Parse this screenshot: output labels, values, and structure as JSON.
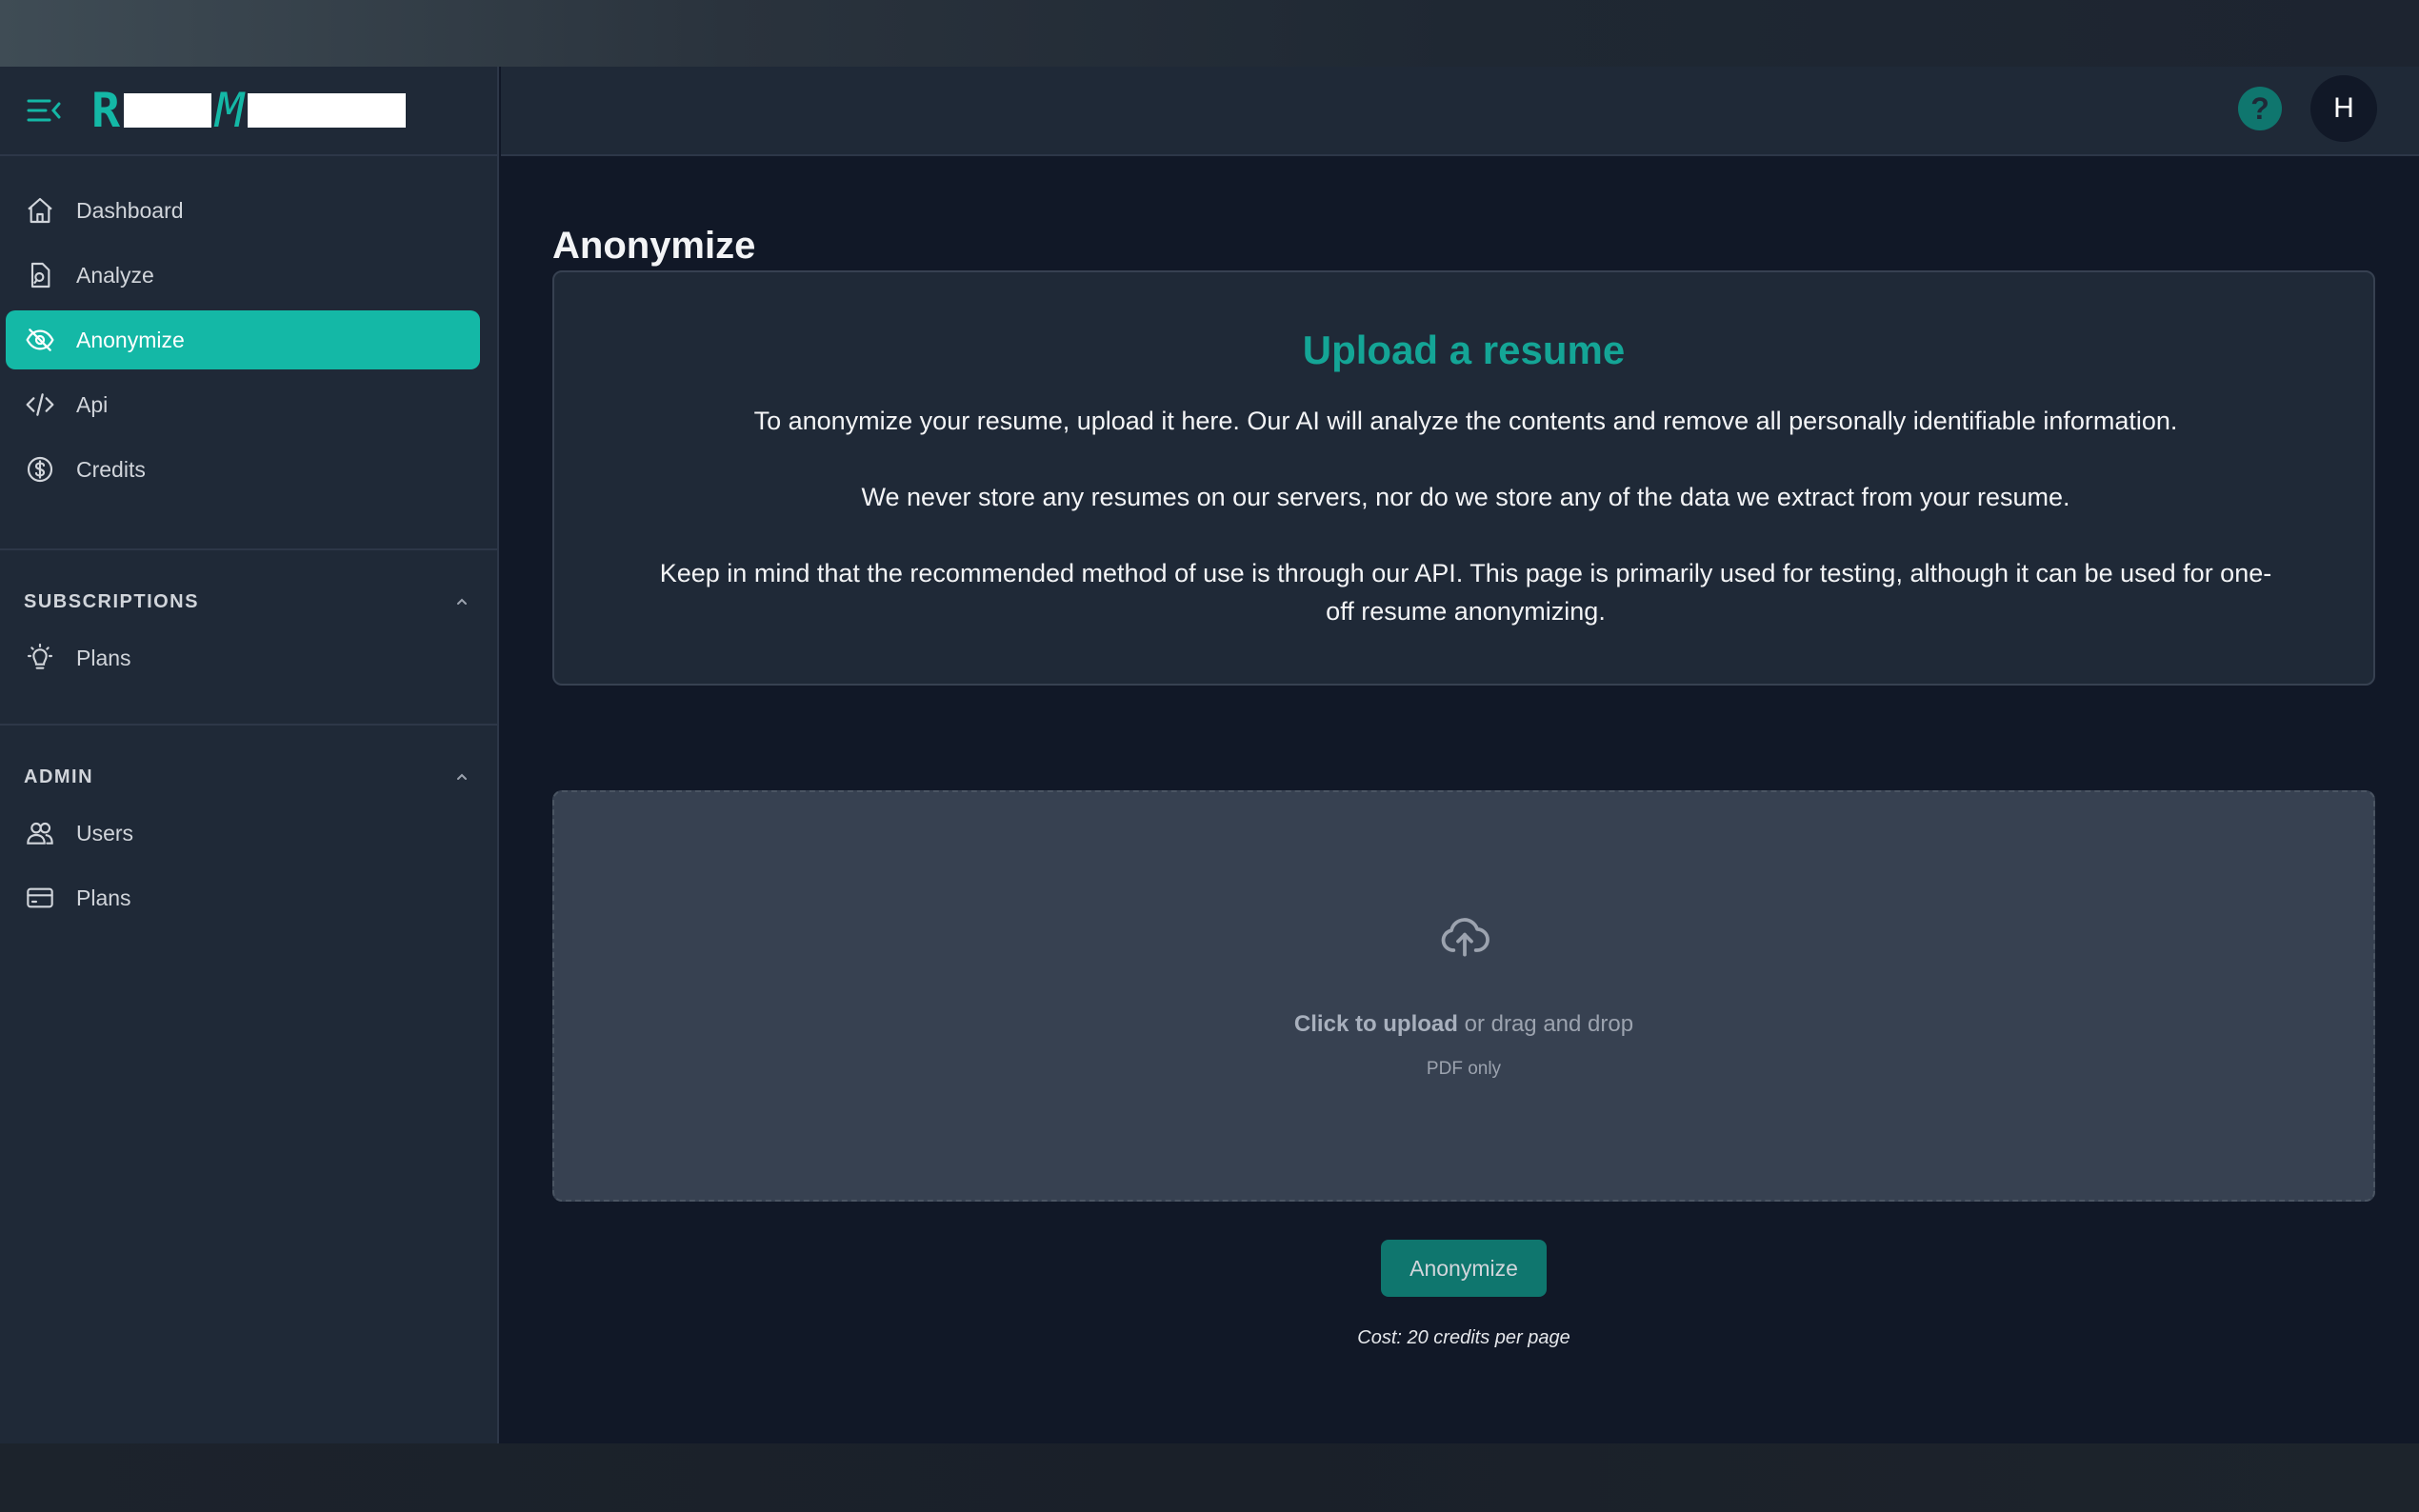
{
  "sidebar": {
    "brand": {
      "letter1": "R",
      "letter2": "M"
    },
    "nav": [
      {
        "label": "Dashboard",
        "icon": "home-icon"
      },
      {
        "label": "Analyze",
        "icon": "document-search-icon"
      },
      {
        "label": "Anonymize",
        "icon": "eye-slash-icon",
        "active": true
      },
      {
        "label": "Api",
        "icon": "code-icon"
      },
      {
        "label": "Credits",
        "icon": "dollar-circle-icon"
      }
    ],
    "subscriptions": {
      "title": "SUBSCRIPTIONS",
      "items": [
        {
          "label": "Plans",
          "icon": "lightbulb-icon"
        }
      ]
    },
    "admin": {
      "title": "ADMIN",
      "items": [
        {
          "label": "Users",
          "icon": "users-icon"
        },
        {
          "label": "Plans",
          "icon": "credit-card-icon"
        }
      ]
    }
  },
  "header": {
    "help": "?",
    "avatar_initial": "H"
  },
  "main": {
    "title": "Anonymize",
    "card": {
      "title": "Upload a resume",
      "p1": "To anonymize your resume, upload it here. Our AI will analyze the contents and remove all personally identifiable information.",
      "p2": "We never store any resumes on our servers, nor do we store any of the data we extract from your resume.",
      "p3": "Keep in mind that the recommended method of use is through our API. This page is primarily used for testing, although it can be used for one-off resume anonymizing."
    },
    "dropzone": {
      "click_text": "Click to upload",
      "rest_text": " or drag and drop",
      "sub": "PDF only"
    },
    "button_label": "Anonymize",
    "cost": "Cost: 20 credits per page"
  },
  "colors": {
    "accent": "#14b8a6",
    "accent_dark": "#0f766e",
    "background": "#111827",
    "panel": "#1f2937"
  }
}
